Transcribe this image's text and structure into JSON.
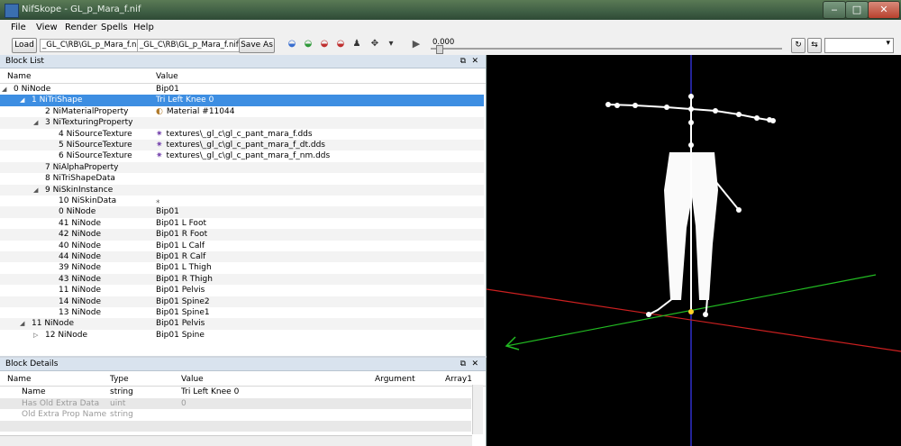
{
  "window": {
    "title": "NifSkope - GL_p_Mara_f.nif"
  },
  "menu": [
    "File",
    "View",
    "Render",
    "Spells",
    "Help"
  ],
  "toolbar": {
    "load_label": "Load",
    "load_path": "_GL_C\\RB\\GL_p_Mara_f.nif",
    "save_path": "_GL_C\\RB\\GL_p_Mara_f.nif",
    "save_as_label": "Save As",
    "time_value": "0.000"
  },
  "block_list": {
    "title": "Block List",
    "col_name": "Name",
    "col_value": "Value",
    "rows": [
      {
        "name": "0  NiNode",
        "value": "Bip01",
        "indent": 0,
        "arrow": "open"
      },
      {
        "name": "1  NiTriShape",
        "value": "Tri Left Knee 0",
        "indent": 1,
        "arrow": "open",
        "selected": true
      },
      {
        "name": "2  NiMaterialProperty",
        "value": "Material #11044",
        "indent": 2,
        "icon": "material-icon"
      },
      {
        "name": "3  NiTexturingProperty",
        "value": "",
        "indent": 2,
        "arrow": "open"
      },
      {
        "name": "4  NiSourceTexture",
        "value": "textures\\_gl_c\\gl_c_pant_mara_f.dds",
        "indent": 3,
        "icon": "texture-icon"
      },
      {
        "name": "5  NiSourceTexture",
        "value": "textures\\_gl_c\\gl_c_pant_mara_f_dt.dds",
        "indent": 3,
        "icon": "texture-icon"
      },
      {
        "name": "6  NiSourceTexture",
        "value": "textures\\_gl_c\\gl_c_pant_mara_f_nm.dds",
        "indent": 3,
        "icon": "texture-icon"
      },
      {
        "name": "7  NiAlphaProperty",
        "value": "",
        "indent": 2
      },
      {
        "name": "8  NiTriShapeData",
        "value": "",
        "indent": 2
      },
      {
        "name": "9  NiSkinInstance",
        "value": "",
        "indent": 2,
        "arrow": "open"
      },
      {
        "name": "10  NiSkinData",
        "value": "",
        "indent": 3,
        "icon": "skin-icon"
      },
      {
        "name": "0  NiNode",
        "value": "Bip01",
        "indent": 3
      },
      {
        "name": "41  NiNode",
        "value": "Bip01 L Foot",
        "indent": 3
      },
      {
        "name": "42  NiNode",
        "value": "Bip01 R Foot",
        "indent": 3
      },
      {
        "name": "40  NiNode",
        "value": "Bip01 L Calf",
        "indent": 3
      },
      {
        "name": "44  NiNode",
        "value": "Bip01 R Calf",
        "indent": 3
      },
      {
        "name": "39  NiNode",
        "value": "Bip01 L Thigh",
        "indent": 3
      },
      {
        "name": "43  NiNode",
        "value": "Bip01 R Thigh",
        "indent": 3
      },
      {
        "name": "11  NiNode",
        "value": "Bip01 Pelvis",
        "indent": 3
      },
      {
        "name": "14  NiNode",
        "value": "Bip01 Spine2",
        "indent": 3
      },
      {
        "name": "13  NiNode",
        "value": "Bip01 Spine1",
        "indent": 3
      },
      {
        "name": "11  NiNode",
        "value": "Bip01 Pelvis",
        "indent": 1,
        "arrow": "open"
      },
      {
        "name": "12  NiNode",
        "value": "Bip01 Spine",
        "indent": 2,
        "arrow": "closed"
      }
    ]
  },
  "block_details": {
    "title": "Block Details",
    "columns": [
      "Name",
      "Type",
      "Value",
      "Argument",
      "Array1"
    ],
    "rows": [
      {
        "name": "Name",
        "type": "string",
        "value": "Tri Left Knee 0",
        "grey": false
      },
      {
        "name": "Has Old Extra Data",
        "type": "uint",
        "value": "0",
        "grey": true
      },
      {
        "name": "Old Extra Prop Name",
        "type": "string",
        "value": "",
        "grey": true
      },
      {
        "name": "",
        "type": "",
        "value": "",
        "grey": true
      }
    ]
  },
  "colors": {
    "accent": "#3d8ee2",
    "axis_x": "#cc2020",
    "axis_y": "#3030cc",
    "axis_z": "#22bb22",
    "skeleton": "#ffffff"
  }
}
